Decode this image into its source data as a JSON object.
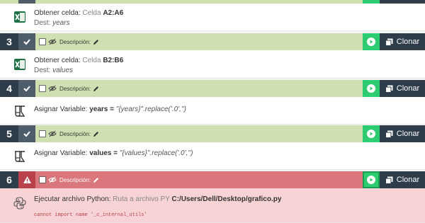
{
  "common": {
    "desc_label": "Descripción:",
    "clone_label": "Clonar"
  },
  "step_top": {
    "line1_label": "Obtener celda:",
    "line1_muted": "Celda",
    "line1_value": "A2:A6",
    "line2_label": "Dest:",
    "line2_value": "years"
  },
  "steps": [
    {
      "num": "3",
      "status": "ok",
      "line1_label": "Obtener celda:",
      "line1_muted": "Celda",
      "line1_value": "B2:B6",
      "line2_label": "Dest:",
      "line2_value": "values"
    },
    {
      "num": "4",
      "status": "ok",
      "line1_label": "Asignar Variable:",
      "var_name": "years",
      "eq": "=",
      "expr": "\"{years}\".replace('.0','')"
    },
    {
      "num": "5",
      "status": "ok",
      "line1_label": "Asignar Variable:",
      "var_name": "values",
      "eq": "=",
      "expr": "\"{values}\".replace('.0','')"
    },
    {
      "num": "6",
      "status": "error",
      "line1_label": "Ejecutar archivo Python:",
      "line1_muted": "Ruta a archivo PY",
      "line1_value": "C:/Users/Dell/Desktop/grafico.py",
      "error": "cannot import name '_c_internal_utils'"
    }
  ],
  "colors": {
    "ok_bar": "#cfe0b0",
    "error_bar": "#d9777c",
    "play": "#2ecc71",
    "dark": "#2f3d4a"
  }
}
